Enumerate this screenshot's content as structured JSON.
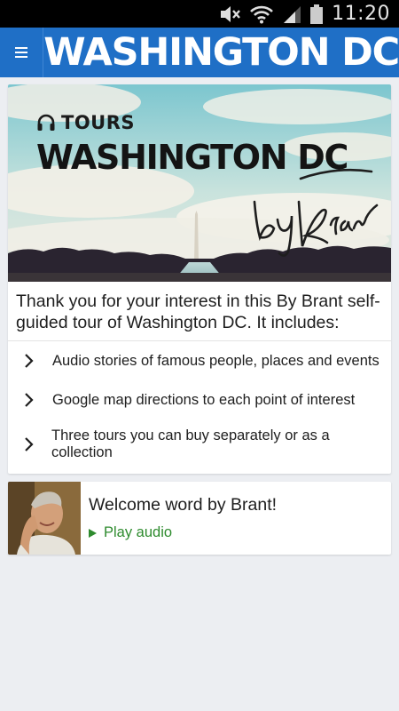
{
  "status_bar": {
    "time": "11:20",
    "icons": [
      "mute-icon",
      "wifi-icon",
      "signal-icon",
      "battery-icon"
    ]
  },
  "app_bar": {
    "menu_icon": "hamburger-menu-icon",
    "title": "WASHINGTON DC"
  },
  "hero": {
    "tours_label": "TOURS",
    "headphones_icon": "headphones-icon",
    "title": "WASHINGTON DC",
    "signature": "by Brant"
  },
  "intro_text": "Thank you for your interest in this By Brant self-guided tour of Washington DC. It includes:",
  "features": [
    {
      "label": "Audio stories of famous people, places and events"
    },
    {
      "label": "Google map directions to each point of interest"
    },
    {
      "label": "Three tours you can buy separately or as a collection"
    }
  ],
  "welcome": {
    "title": "Welcome word by Brant!",
    "play_label": "Play audio",
    "accent_color": "#2e8b2e"
  },
  "colors": {
    "app_bar": "#1f6fc6",
    "background": "#eceef2"
  }
}
